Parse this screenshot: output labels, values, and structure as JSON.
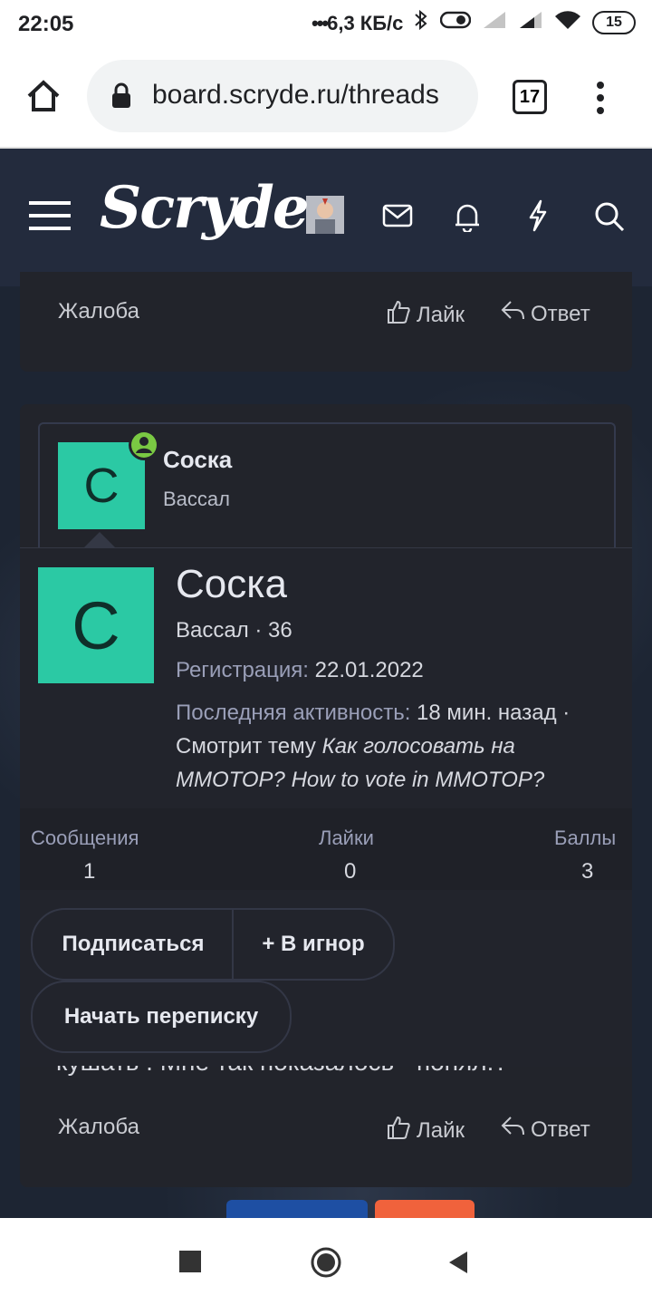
{
  "status_bar": {
    "time": "22:05",
    "network_speed": "6,3 КБ/с",
    "battery": "15"
  },
  "browser": {
    "url": "board.scryde.ru/threads",
    "tabs_count": "17"
  },
  "header": {
    "logo_text": "Scryde"
  },
  "post_actions_top": {
    "report": "Жалоба",
    "like": "Лайк",
    "reply": "Ответ"
  },
  "user_card": {
    "avatar_letter": "С",
    "name": "Соска",
    "title": "Вассал"
  },
  "popup": {
    "avatar_letter": "С",
    "name": "Соска",
    "title_line": "Вассал · 36",
    "registration_label": "Регистрация:",
    "registration_value": "22.01.2022",
    "last_activity_label": "Последняя активность:",
    "last_activity_value": "18 мин. назад ·",
    "activity_prefix": "Смотрит тему",
    "activity_topic": "Как голосовать на MMOTOP? How to vote in MMOTOP?",
    "stats": [
      {
        "label": "Сообщения",
        "value": "1"
      },
      {
        "label": "Лайки",
        "value": "0"
      },
      {
        "label": "Баллы",
        "value": "3"
      }
    ],
    "buttons": {
      "subscribe": "Подписаться",
      "ignore": "+ В игнор",
      "message": "Начать переписку"
    }
  },
  "post_fragment": "кушать . Мне так показалось - понял!?",
  "post_actions_bottom": {
    "report": "Жалоба",
    "like": "Лайк",
    "reply": "Ответ"
  },
  "colors": {
    "header_bg": "#232b3d",
    "avatar_bg": "#2bc9a4",
    "online_badge": "#7ac943",
    "card_bg": "#22242b"
  }
}
